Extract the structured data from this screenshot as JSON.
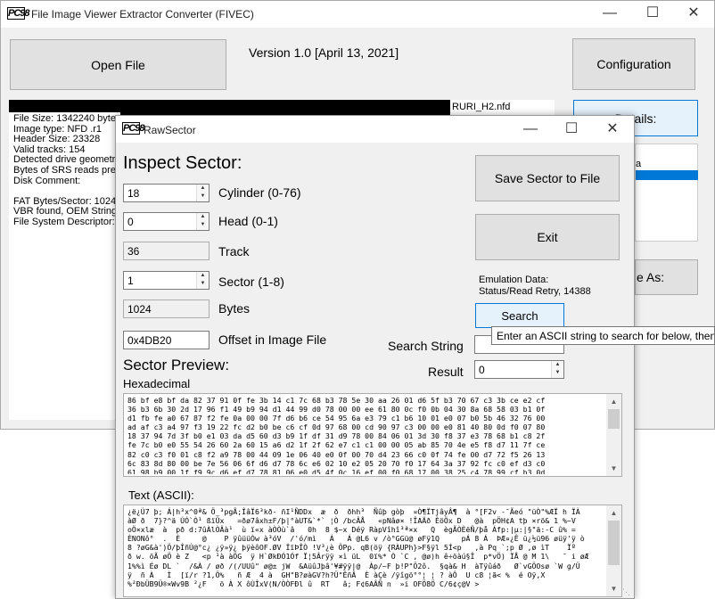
{
  "main": {
    "title": "File Image Viewer Extractor Converter (FIVEC)",
    "open_file_label": "Open File",
    "version_text": "Version  1.0 [April 13, 2021]",
    "configuration_label": "Configuration",
    "file_path_suffix": "RURI_H2.nfd",
    "details_label": "Details:",
    "save_as_label": "e As:",
    "list_partial_text": "a",
    "info_lines": [
      "File Size: 1342240 bytes",
      "Image type: NFD .r1",
      "Header Size: 23328",
      "Valid tracks: 154",
      "Detected drive geometry",
      "Bytes of SRS reads prese",
      "Disk Comment:",
      "",
      "FAT Bytes/Sector: 1024",
      "VBR found, OEM String:",
      "File System Descriptor: _"
    ]
  },
  "rawsector": {
    "title": "RawSector",
    "inspect_heading": "Inspect Sector:",
    "cylinder_value": "18",
    "cylinder_label": "Cylinder (0-76)",
    "head_value": "0",
    "head_label": "Head (0-1)",
    "track_value": "36",
    "track_label": "Track",
    "sector_value": "1",
    "sector_label": "Sector (1-8)",
    "bytes_value": "1024",
    "bytes_label": "Bytes",
    "offset_value": "0x4DB20",
    "offset_label": "Offset in Image File",
    "save_sector_label": "Save Sector to File",
    "exit_label": "Exit",
    "emulation_label": "Emulation Data:",
    "emulation_status": "Status/Read Retry, 14388",
    "search_label": "Search",
    "tooltip": "Enter an ASCII string to search for below, then",
    "search_string_label": "Search String",
    "search_string_value": "",
    "result_label": "Result",
    "result_value": "0",
    "preview_heading": "Sector Preview:",
    "hex_label": "Hexadecimal",
    "hex_lines": [
      "86 bf e8 bf da 82 37 91 0f fe 3b 14 c1 7c 68 b3 78 5e 30 aa 26 01 d6 5f b3 70 67 c3 3b ce e2 cf",
      "36 b3 6b 30 2d 17 96 f1 49 b9 94 d1 44 99 d0 78 00 00 ee 61 80 0c f0 0b 04 30 8a 68 58 03 b1 0f",
      "d1 fb fe a0 67 87 f2 fe 0a 00 00 7f d6 b6 ce 54 95 6a e3 79 c1 b6 10 01 e0 07 b0 5b 46 32 76 00",
      "ad af c3 a4 97 f3 19 22 fc d2 b0 be c6 cf 0d 97 68 00 cd 90 97 c3 00 00 e0 81 40 80 0d f0 07 80",
      "18 37 94 7d 3f b0 e1 03 da d5 60 d3 b9 1f df 31 d9 78 00 84 06 01 3d 30 f8 37 e3 78 68 b1 c8 2f",
      "fe 7c b0 e0 55 54 26 60 2a 60 15 a6 d2 1f 2f 62 e7 c1 c1 00 00 05 ab 85 70 4e e5 f8 d7 11 7f ce",
      "82 c0 c3 f0 01 c8 f2 a9 78 00 44 09 1e 06 40 e0 0f 00 70 d4 23 66 c0 0f 74 fe 00 d7 72 f5 26 13",
      "6c 83 8d 80 00 be 7e 56 06 6f d6 d7 78 6c e6 02 10 e2 05 20 70 f0 17 64 3a 37 92 fc c0 ef d3 c0",
      "61 98 b9 00 1f f9 9c d6 ef d7 78 81 06 e0 d5 4f 0c 16 ef 00 f0 68 17 00 38 25 c4 78 99 cf b3 0d"
    ],
    "ascii_label": "Text (ASCII):",
    "ascii_lines": [
      "¿ë¿Ú7 þ; Á|h³x^0ª& Ö_³pgÃ;ÎâÏ6³kð- ñI¹ÑDDx  æ  ð  ðhh³  Ñûþ gòþ  ¤Ò¶ÏTjâyÂ¶  à °[F2v -¯Ãeó \"üÒ\"%ÆÏ h ÏÀ",
      "àØ ð  7}?^ä ÚÒ`Ò¹ ßïÛx   =ðø7âxh±F/þ|°àUT&`*` ¦Ò /bcÂÅ   «pNâø× !ÎAÄð ÈöÖx D   @à  pÖH¢A tþ ×rö& 1 %~V",
      "oÖ×xlæ  à  pð d:7ûÀlÒÂà¹  ù ï«x àÒÒù`â   0h  8 $~x Déÿ RàpVîhî³ª×x   Q  ègÃÒÈëÑ/þå Áfp:|µ:|§\"ä:-C û% =",
      "ÈNONô°  .  È     @    P ÿûüüÒw à³óV  /'ó/mì   Á   Á @L6 v /ò°GGü@ øFÿ1Q     pÁ 8 Á  ÞÆ¤¿Ê ü¿½ü96 øüÿ'ÿ ò",
      "8 ?øG&à')Ö/þÎñÚ@°c¿ ¿ÿ»ÿ¿ þÿèôOF.ØV ÏïÞÎÒ !V³¿è ÖPp. qB(öÿ {RÀUPh}>F§ÿl 5Í<p   ,à Pq `;p Ø ,ø ìT    Ïº",
      "ð w. öÃ øÖ è Z   <p ¹à àÖG  ÿ H`ØkÐÓ1Óf Ï¦5Ârÿÿ ×ì üL  0ï%* Ò `C , @ø)h ê÷öàú§Î  p*vÖ) ÏÅ @ M 1\\   ¯ i øÆ",
      "1%%ì Éø DL `  /&À / øð /(/UUû\" ø@± jW  &AüûJþâ'¥#ÿÿ|@  Àp/~F þ!P\"Ö2ô.  §qà& H  àTÿûáð   Ø`vGÖOsø `W g/Ü",
      "ÿ  ñ À   Ì  [ï/r ?1,Ö%   ñ Æ  4 à  GH\"B?øàGV?h?Ü\"ÊñÂ  È àÇè /ÿîgö°°¦ ¦ ? àÔ  U c8 ¦ã< %  é Oÿ,X",
      "%²ÐbÜB9Ü®×Wv9B ²¿F   ö À X ôÙÎxV(N/ÒÒFÐl û  RT   â; F¢6AÂÑ n  »i OFÖ8Ö C/6¢ç@V >"
    ]
  }
}
